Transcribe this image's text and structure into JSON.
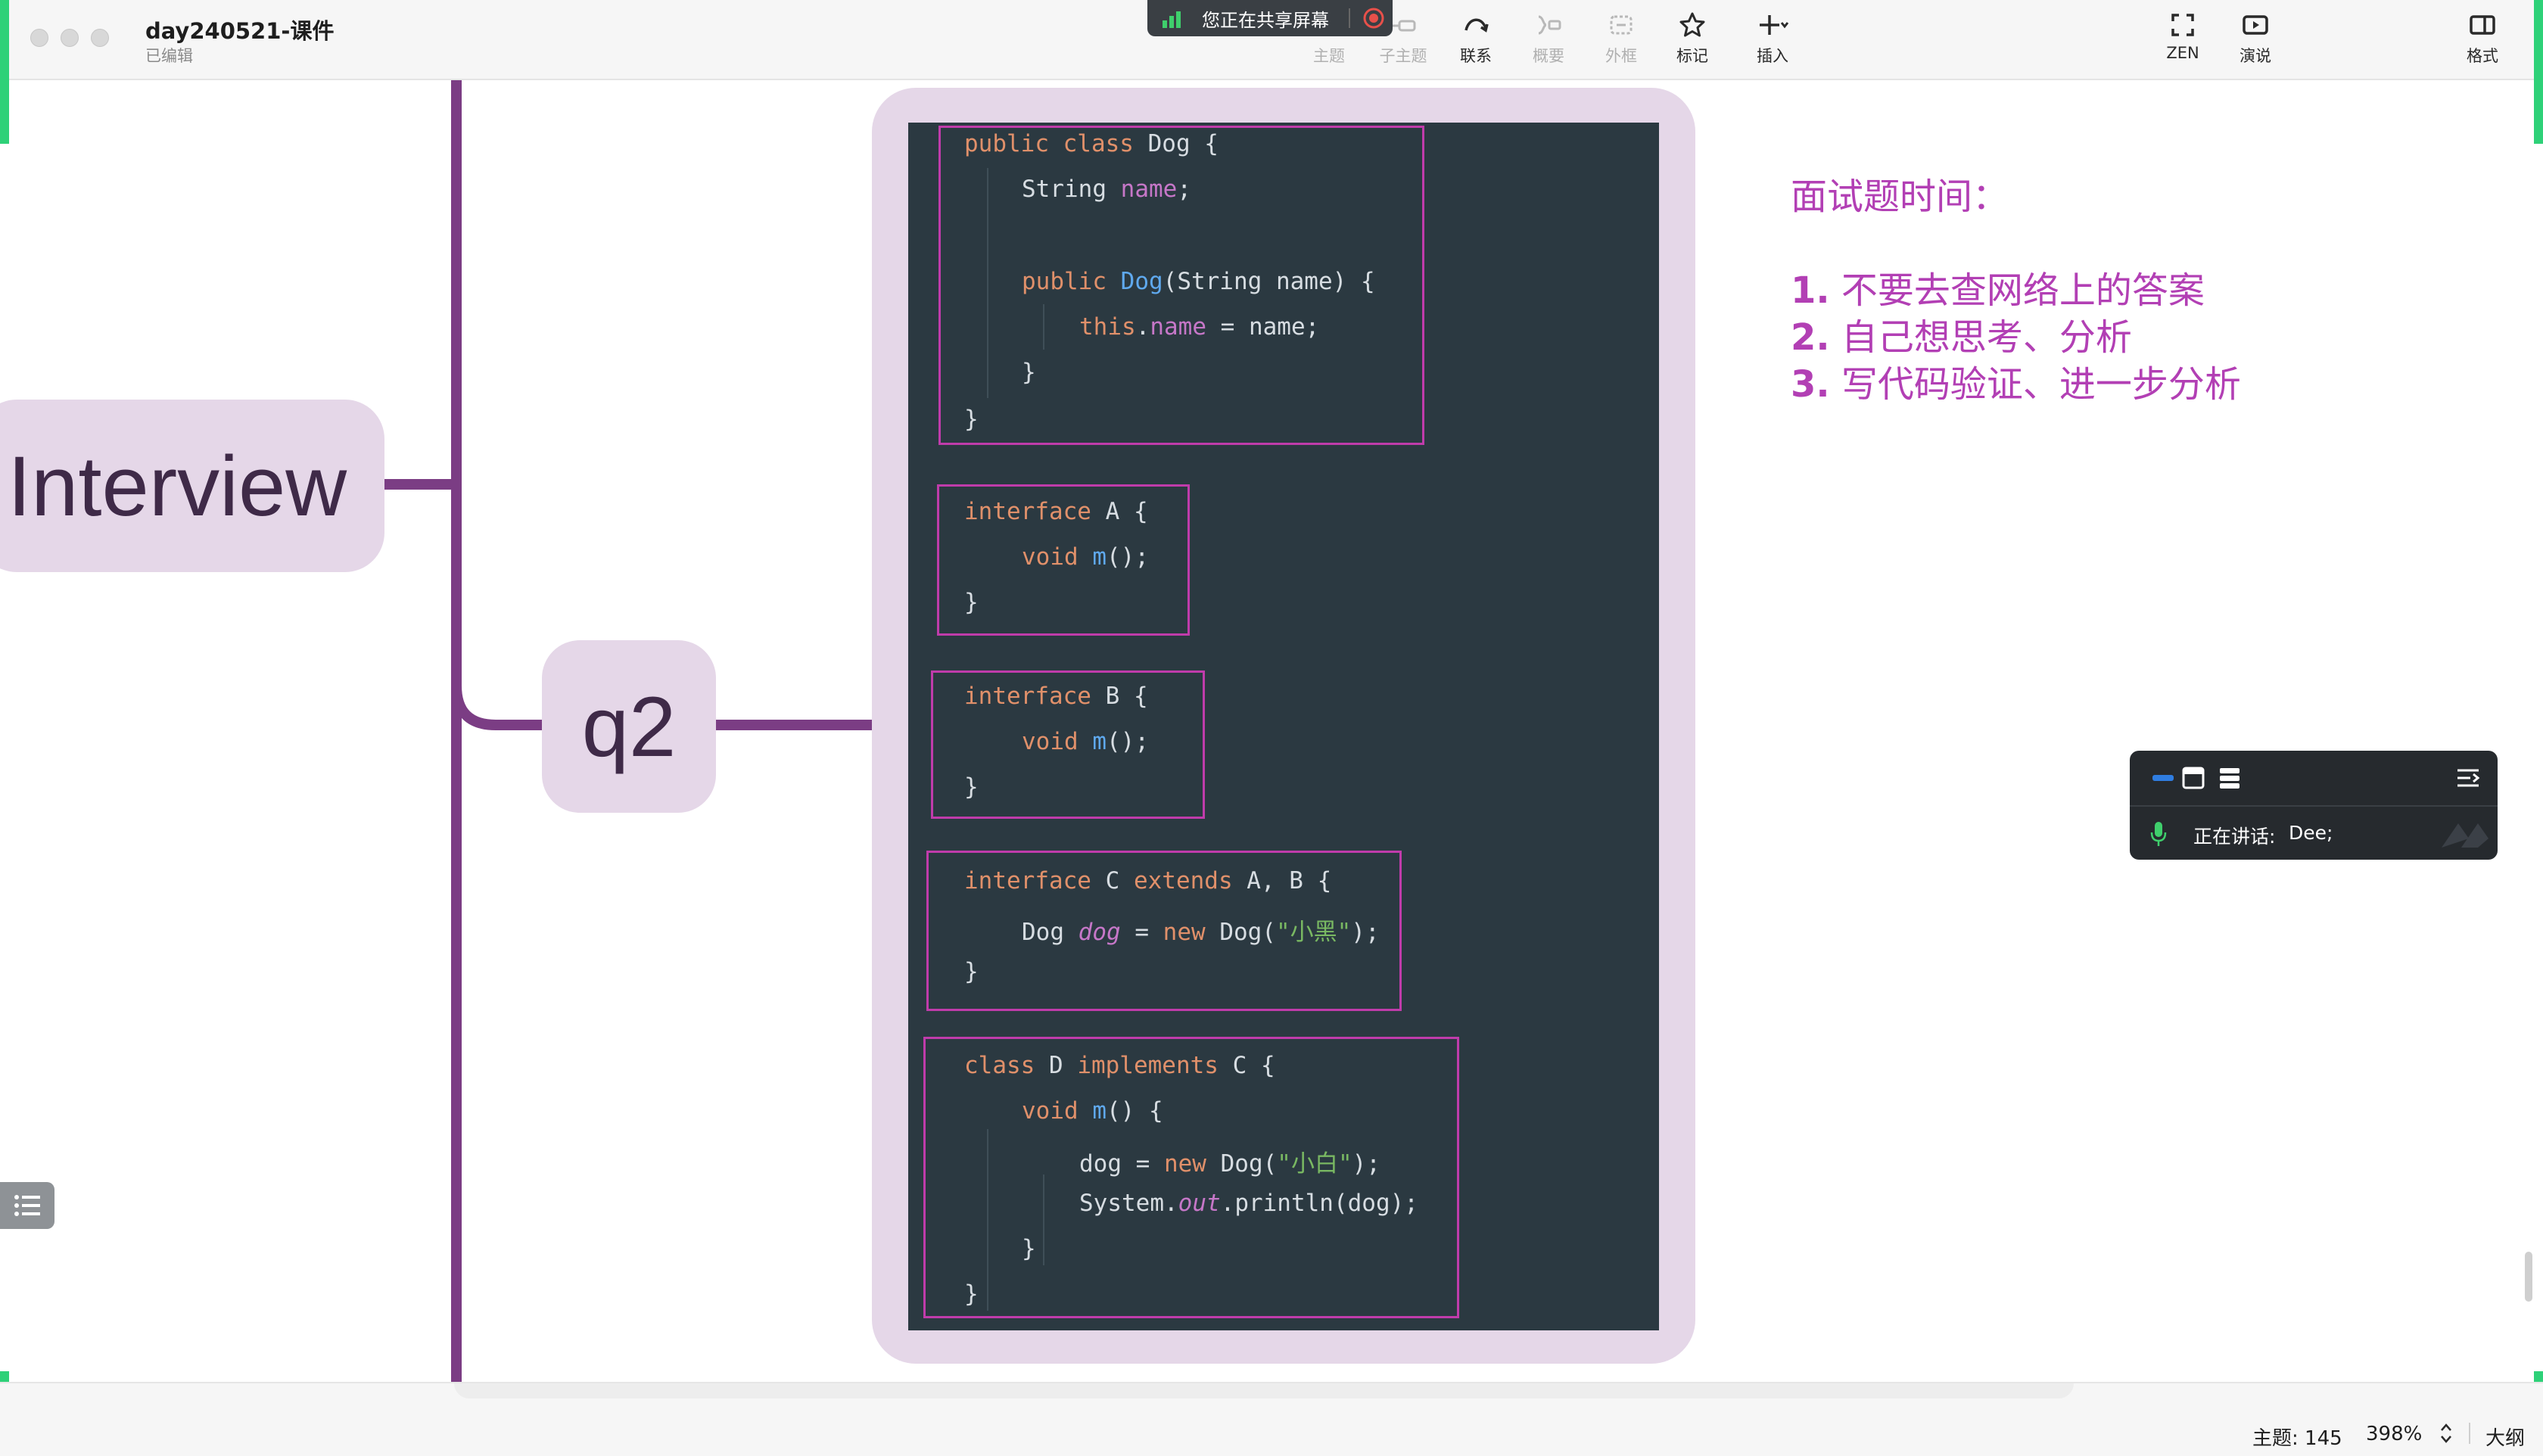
{
  "window": {
    "title": "day240521-课件",
    "subtitle": "已编辑"
  },
  "share_banner": {
    "text": "您正在共享屏幕"
  },
  "toolbar": {
    "items": [
      {
        "label": "主题",
        "icon": "topic-icon"
      },
      {
        "label": "子主题",
        "icon": "subtopic-icon"
      },
      {
        "label": "联系",
        "icon": "relationship-icon"
      },
      {
        "label": "概要",
        "icon": "summary-icon"
      },
      {
        "label": "外框",
        "icon": "boundary-icon"
      },
      {
        "label": "标记",
        "icon": "star-icon"
      },
      {
        "label": "插入",
        "icon": "plus-icon"
      },
      {
        "label": "ZEN",
        "icon": "fullscreen-icon"
      },
      {
        "label": "演说",
        "icon": "present-icon"
      },
      {
        "label": "格式",
        "icon": "format-panel-icon"
      }
    ]
  },
  "mindmap": {
    "root_topic": "Interview",
    "child_topic": "q2"
  },
  "code": {
    "block1": [
      "public class Dog {",
      "String name;",
      "public Dog(String name) {",
      "this.name = name;",
      "}",
      "}"
    ],
    "block2": [
      "interface A {",
      "void m();",
      "}"
    ],
    "block3": [
      "interface B {",
      "void m();",
      "}"
    ],
    "block4": [
      "interface C extends A, B {",
      "Dog dog = new Dog(\"小黑\");",
      "}"
    ],
    "block5": [
      "class D implements C {",
      "void m() {",
      "dog = new Dog(\"小白\");",
      "System.out.println(dog);",
      "}",
      "}"
    ]
  },
  "note": {
    "title": "面试题时间：",
    "items": [
      {
        "num": "1.",
        "text": "不要去查网络上的答案"
      },
      {
        "num": "2.",
        "text": "自己想思考、分析"
      },
      {
        "num": "3.",
        "text": "写代码验证、进一步分析"
      }
    ]
  },
  "meeting_panel": {
    "speaking_label": "正在讲话:",
    "speaker": "Dee;"
  },
  "status_bar": {
    "topics": "主题: 145",
    "zoom": "398%",
    "outline": "大纲"
  },
  "colors": {
    "branch": "#7b3d84",
    "topic_fill": "#e5d7e8",
    "code_bg": "#2b3941",
    "highlight_box": "#c03cab",
    "note_text": "#b23fb4",
    "screen_share_green": "#2ed178"
  }
}
